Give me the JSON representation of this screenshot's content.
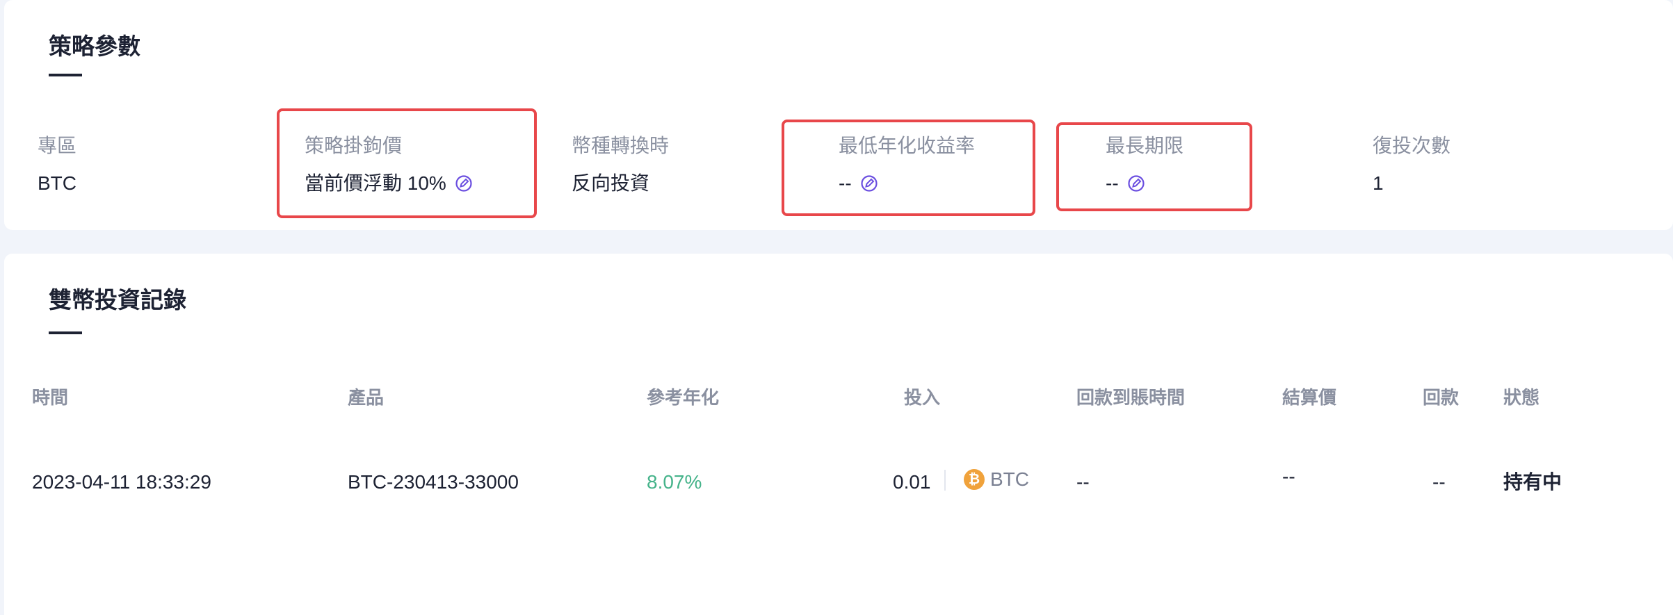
{
  "params": {
    "title": "策略參數",
    "items": [
      {
        "label": "專區",
        "value": "BTC"
      },
      {
        "label": "策略掛鉤價",
        "value": "當前價浮動 10%"
      },
      {
        "label": "幣種轉換時",
        "value": "反向投資"
      },
      {
        "label": "最低年化收益率",
        "value": "--"
      },
      {
        "label": "最長期限",
        "value": "--"
      },
      {
        "label": "復投次數",
        "value": "1"
      }
    ]
  },
  "records": {
    "title": "雙幣投資記錄",
    "columns": [
      "時間",
      "產品",
      "參考年化",
      "投入",
      "回款到賬時間",
      "結算價",
      "回款",
      "狀態"
    ],
    "rows": [
      {
        "time": "2023-04-11 18:33:29",
        "product": "BTC-230413-33000",
        "apy": "8.07%",
        "amount": "0.01",
        "coin": "BTC",
        "coin_symbol": "₿",
        "payout_time": "--",
        "settle_price": "--",
        "payout": "--",
        "status": "持有中"
      }
    ]
  },
  "colors": {
    "highlight": "#e8474a",
    "apy_green": "#45b38a",
    "edit_icon": "#6b4fe0",
    "btc_orange": "#f0a23b"
  },
  "icons": {
    "edit": "edit-pencil-icon",
    "coin": "btc-coin-icon"
  }
}
